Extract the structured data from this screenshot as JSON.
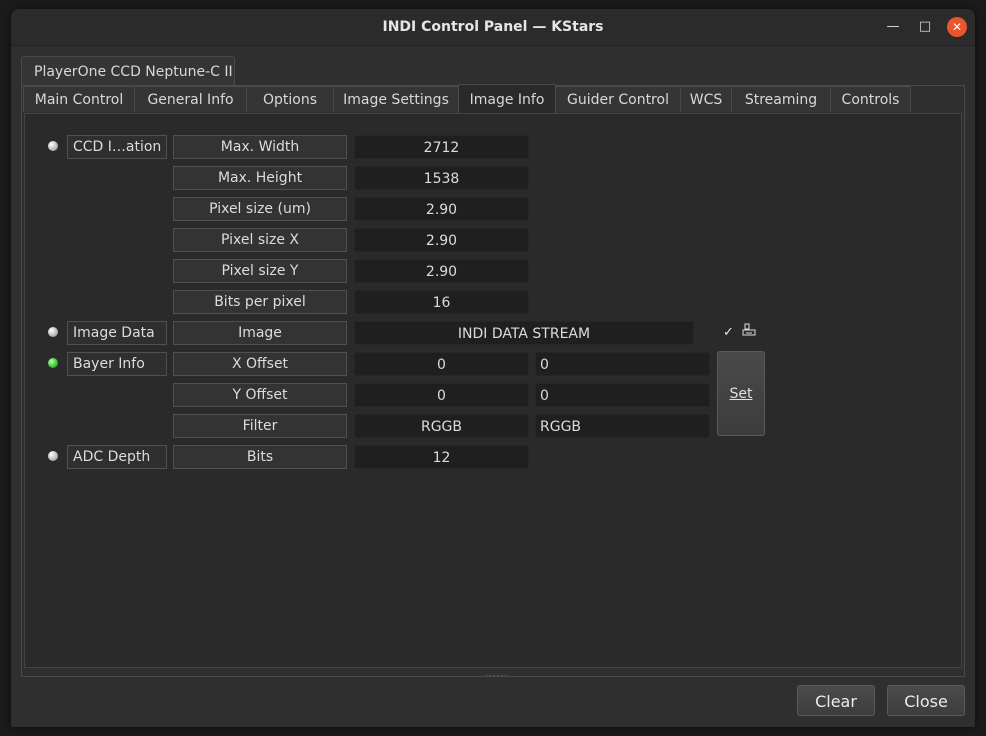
{
  "window": {
    "title": "INDI Control Panel — KStars"
  },
  "device_tab": "PlayerOne CCD Neptune-C II",
  "tabs": [
    "Main Control",
    "General Info",
    "Options",
    "Image Settings",
    "Image Info",
    "Guider Control",
    "WCS",
    "Streaming",
    "Controls"
  ],
  "active_tab": "Image Info",
  "groups": {
    "ccd_info": "CCD I…ation",
    "image_data": "Image Data",
    "bayer_info": "Bayer Info",
    "adc_depth": "ADC Depth"
  },
  "ccd_info": {
    "max_width": {
      "label": "Max. Width",
      "value": "2712"
    },
    "max_height": {
      "label": "Max. Height",
      "value": "1538"
    },
    "pixel_size": {
      "label": "Pixel size (um)",
      "value": "2.90"
    },
    "pixel_size_x": {
      "label": "Pixel size X",
      "value": "2.90"
    },
    "pixel_size_y": {
      "label": "Pixel size Y",
      "value": "2.90"
    },
    "bits_per_pixel": {
      "label": "Bits per pixel",
      "value": "16"
    }
  },
  "image_data": {
    "label": "Image",
    "value": "INDI DATA STREAM",
    "check": "✓"
  },
  "bayer_info": {
    "x_offset": {
      "label": "X Offset",
      "value": "0",
      "input": "0"
    },
    "y_offset": {
      "label": "Y Offset",
      "value": "0",
      "input": "0"
    },
    "filter": {
      "label": "Filter",
      "value": "RGGB",
      "input": "RGGB"
    },
    "set_label": "Set"
  },
  "adc_depth": {
    "label": "Bits",
    "value": "12"
  },
  "buttons": {
    "clear": "Clear",
    "close": "Close"
  },
  "led_colors": {
    "idle": "#b8b8b8",
    "ok": "#37c22c"
  }
}
